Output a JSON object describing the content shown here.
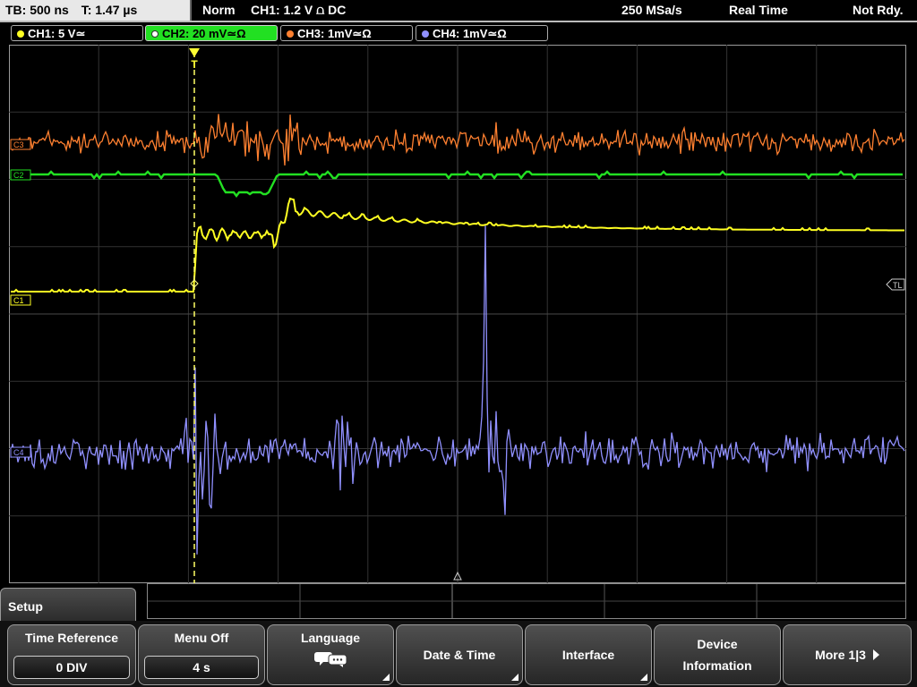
{
  "topbar": {
    "timebase": "TB: 500 ns",
    "trigger_time": "T: 1.47 µs",
    "mode": "Norm",
    "trigger_info": "CH1: 1.2 V ⩍ DC",
    "sample_rate": "250 MSa/s",
    "acq_mode": "Real Time",
    "status": "Not Rdy."
  },
  "channels": [
    {
      "label": "CH1: 5 V≃",
      "color": "#ffff22"
    },
    {
      "label": "CH2: 20 mV≃Ω",
      "color": "#22e022"
    },
    {
      "label": "CH3: 1mV≃Ω",
      "color": "#ff8030"
    },
    {
      "label": "CH4: 1mV≃Ω",
      "color": "#9090ff"
    }
  ],
  "markers": {
    "c3": "C3",
    "c2": "C2",
    "c1": "C1",
    "c4": "C4",
    "trigger_level": "TL",
    "trigger_pos": "T"
  },
  "menu": {
    "title": "Setup",
    "time_reference": {
      "label": "Time Reference",
      "value": "0 DIV"
    },
    "menu_off": {
      "label": "Menu Off",
      "value": "4 s"
    },
    "language": {
      "label": "Language"
    },
    "date_time": {
      "label": "Date & Time"
    },
    "interface": {
      "label": "Interface"
    },
    "device_info": {
      "line1": "Device",
      "line2": "Information"
    },
    "more": {
      "label": "More 1|3"
    }
  }
}
